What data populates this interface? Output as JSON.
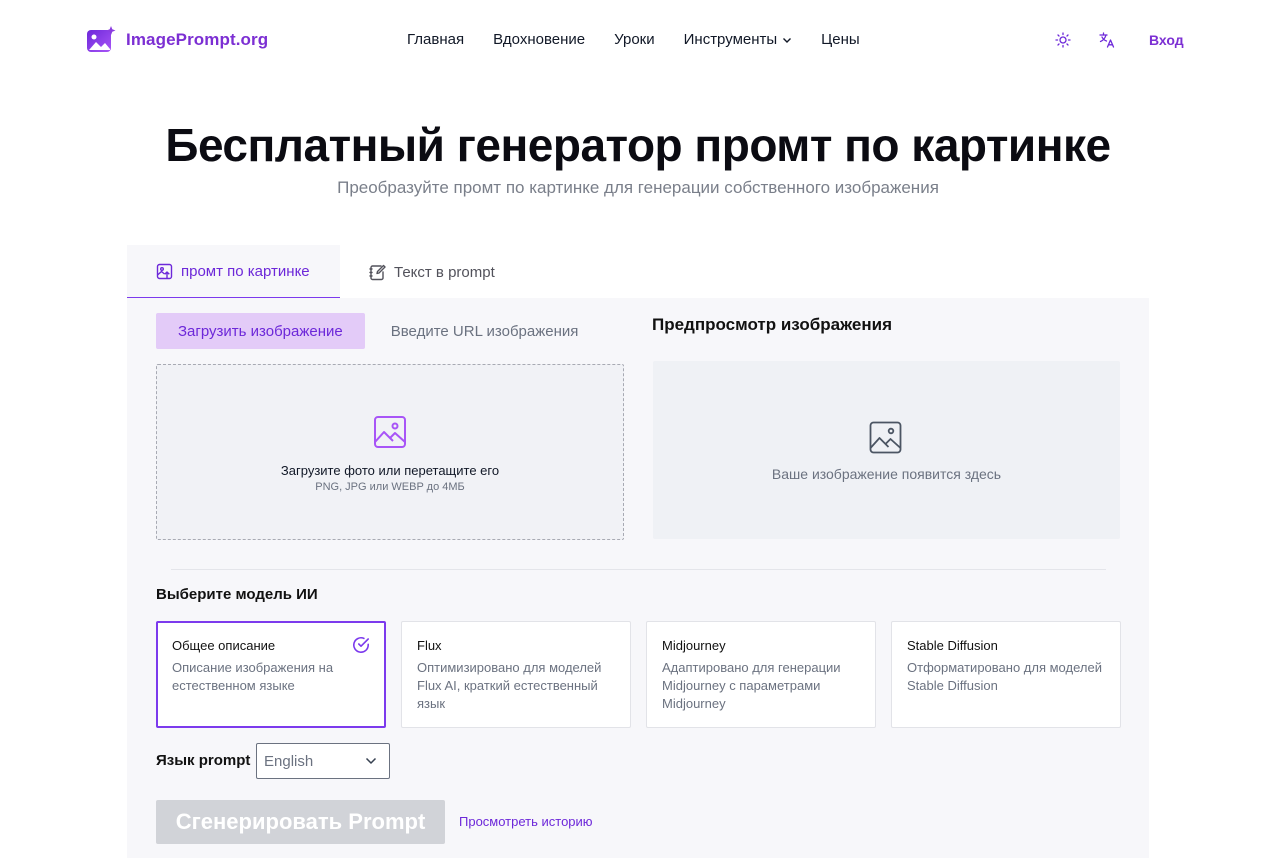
{
  "header": {
    "brand": "ImagePrompt.org",
    "nav": [
      "Главная",
      "Вдохновение",
      "Уроки",
      "Инструменты",
      "Цены"
    ],
    "login": "Вход"
  },
  "hero": {
    "title": "Бесплатный генератор промт по картинке",
    "subtitle": "Преобразуйте промт по картинке для генерации собственного изображения"
  },
  "tabs": [
    {
      "label": "промт по картинке",
      "active": true
    },
    {
      "label": "Текст в prompt",
      "active": false
    }
  ],
  "upload": {
    "subtab_upload": "Загрузить изображение",
    "subtab_url": "Введите URL изображения",
    "drop_text": "Загрузите фото или перетащите его",
    "drop_hint": "PNG, JPG или WEBP до 4МБ"
  },
  "preview": {
    "title": "Предпросмотр изображения",
    "placeholder": "Ваше изображение появится здесь"
  },
  "models": {
    "label": "Выберите модель ИИ",
    "items": [
      {
        "title": "Общее описание",
        "desc": "Описание изображения на естественном языке",
        "selected": true
      },
      {
        "title": "Flux",
        "desc": "Оптимизировано для моделей Flux AI, краткий естественный язык",
        "selected": false
      },
      {
        "title": "Midjourney",
        "desc": "Адаптировано для генерации Midjourney с параметрами Midjourney",
        "selected": false
      },
      {
        "title": "Stable Diffusion",
        "desc": "Отформатировано для моделей Stable Diffusion",
        "selected": false
      }
    ]
  },
  "language": {
    "label": "Язык prompt",
    "value": "English"
  },
  "actions": {
    "generate": "Сгенерировать Prompt",
    "history": "Просмотреть историю"
  },
  "colors": {
    "accent": "#7c3aed",
    "brand": "#7c2fd3",
    "subtab_bg": "#e3cbf8",
    "panel_bg": "#f7f7fa",
    "disabled_btn": "#d1d3d8"
  }
}
